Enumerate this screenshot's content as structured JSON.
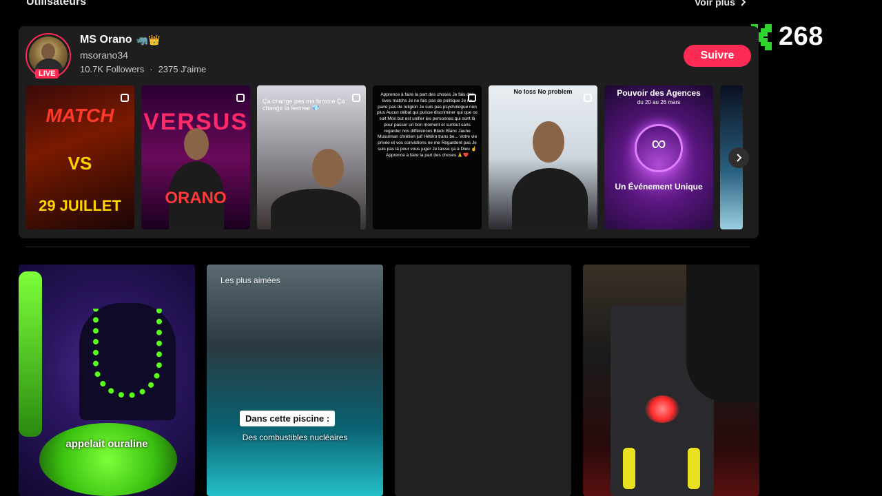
{
  "section": {
    "title": "Utilisateurs",
    "see_all": "Voir plus"
  },
  "watermark": {
    "logo": "K",
    "count": "268",
    "accent": "#2bd52b"
  },
  "user": {
    "name": "MS Orano",
    "name_emojis": "🦏👑",
    "handle": "msorano34",
    "followers": "10.7K Followers",
    "separator": "·",
    "likes": "2375 J'aime",
    "live_label": "LIVE",
    "follow_label": "Suivre",
    "accent": "#fe2c55"
  },
  "thumbnails": [
    {
      "caption_a": "MATCH",
      "caption_b": "VS",
      "caption_c": "29 JUILLET"
    },
    {
      "caption_a": "VERSUS",
      "caption_b": "ORANO"
    },
    {
      "caption_a": "Ça change pas ma femme Ça change la femme 💎"
    },
    {
      "caption_a": "Apprence à faire la part des choses Je fais des lives matchs Je ne fais pas de politique Je ne parle pas de religion Je suis pas psychologue non plus Aucun débat qui puisse discriminer qui que ce soit Mon but est unifier les personnes qui sont là pour passer un bon moment et surtout sans regarder nos différences Black Blanc Jaune Musulman chrétien juif Hétéro trans be... Votre vie privée et vos convictions ne me Regardent pas Je suis pas là pour vous juger Je laisse ça à Dieu ☝️ Apprence à faire la part des choses 🙏❤️"
    },
    {
      "caption_a": "No loss No problem"
    },
    {
      "caption_a": "Pouvoir des Agences",
      "caption_b": "du 20 au 26 mars",
      "caption_c": "Un Événement Unique"
    }
  ],
  "videos": [
    {
      "overlay": "appelait ouraline"
    },
    {
      "label": "Les plus aimées",
      "box": "Dans cette piscine :",
      "sub": "Des combustibles nucléaires"
    },
    {},
    {}
  ]
}
